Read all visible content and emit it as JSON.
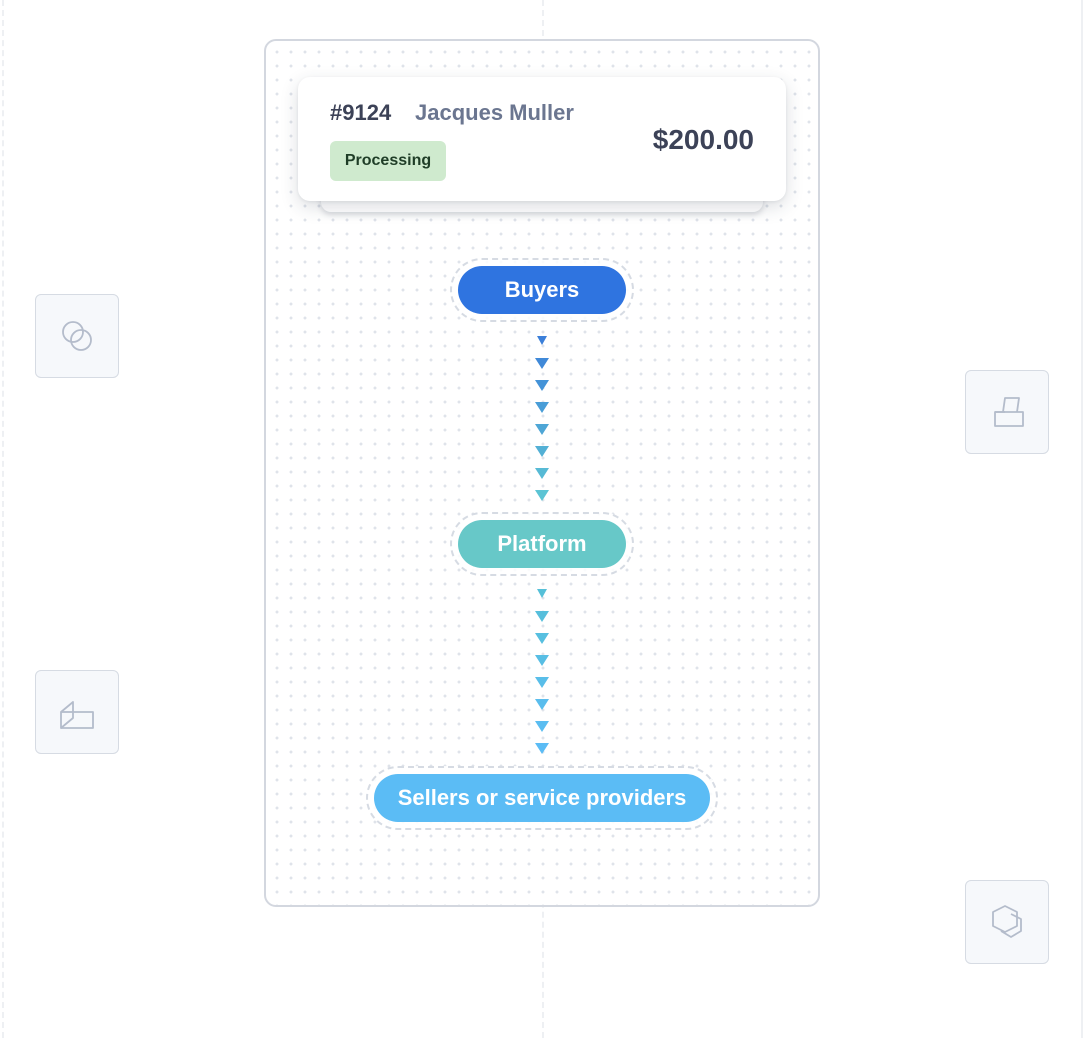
{
  "order_card": {
    "id": "#9124",
    "customer_name": "Jacques Muller",
    "status": "Processing",
    "amount": "$200.00",
    "status_color": "#cfeace"
  },
  "flow": {
    "nodes": [
      {
        "label": "Buyers",
        "color": "#2f74e0"
      },
      {
        "label": "Platform",
        "color": "#67c8c8"
      },
      {
        "label": "Sellers or service providers",
        "color": "#5bbcf5"
      }
    ],
    "connectors": [
      {
        "from": "Buyers",
        "to": "Platform",
        "arrow_count": 8,
        "color_start": "#3b7fd9",
        "color_end": "#5cc4d4"
      },
      {
        "from": "Platform",
        "to": "Sellers or service providers",
        "arrow_count": 8,
        "color_start": "#56c0d8",
        "color_end": "#5bbcf5"
      }
    ]
  },
  "side_icons": [
    "overlapping-circles-icon",
    "stacked-boxes-icon",
    "folded-box-icon",
    "hexagon-icon"
  ]
}
